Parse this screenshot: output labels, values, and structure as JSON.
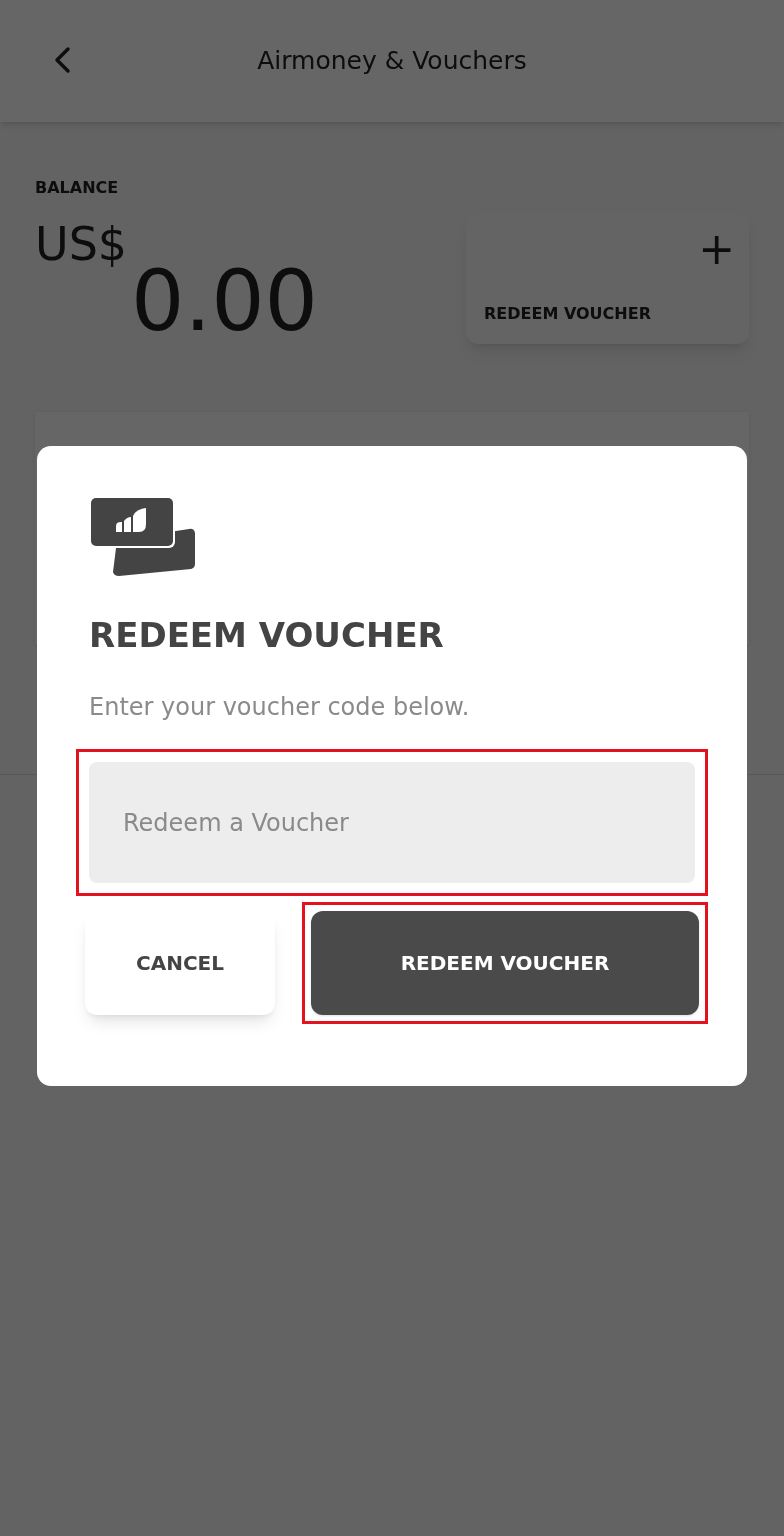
{
  "header": {
    "title": "Airmoney & Vouchers"
  },
  "balance": {
    "label": "BALANCE",
    "currency": "US$",
    "amount": "0.00"
  },
  "redeem_card": {
    "plus": "+",
    "label": "REDEEM VOUCHER"
  },
  "dialog": {
    "title": "REDEEM VOUCHER",
    "message": "Enter your voucher code below.",
    "input": {
      "placeholder": "Redeem a Voucher",
      "highlighted": true
    },
    "buttons": [
      {
        "kind": "secondary",
        "label": "CANCEL",
        "highlighted": false
      },
      {
        "kind": "primary",
        "label": "REDEEM VOUCHER",
        "highlighted": true
      }
    ]
  }
}
